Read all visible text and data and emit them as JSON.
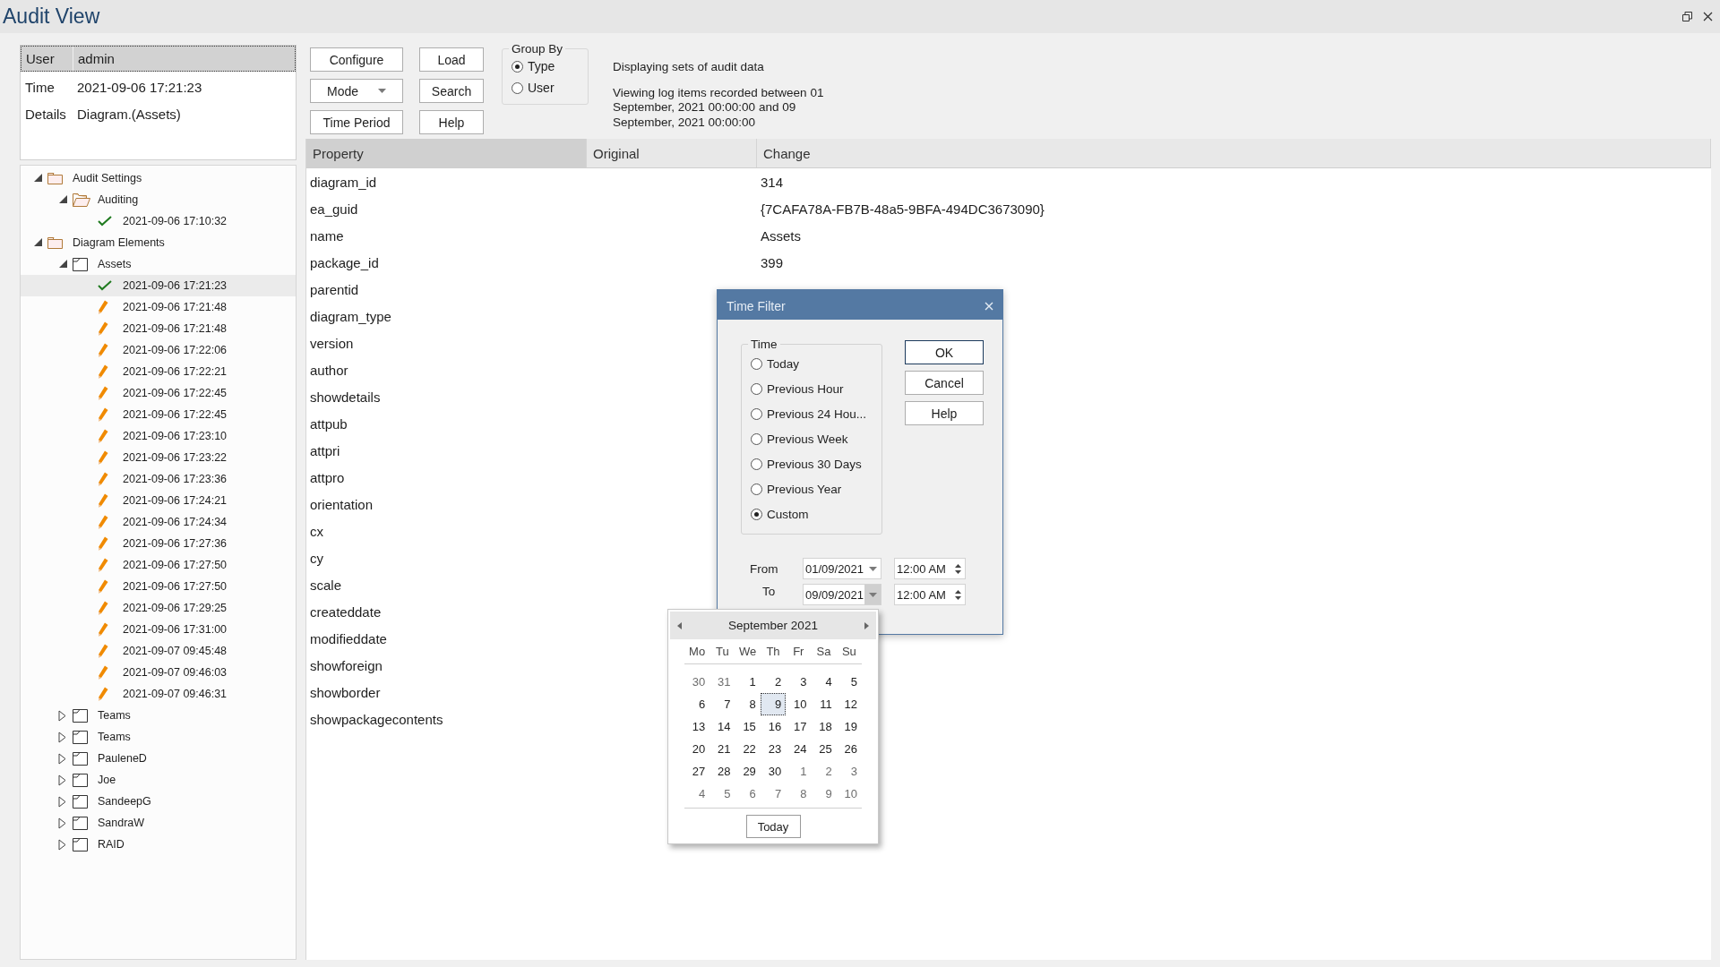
{
  "window": {
    "title": "Audit View"
  },
  "details": {
    "header": {
      "label": "User",
      "value": "admin"
    },
    "rows": [
      {
        "label": "Time",
        "value": "2021-09-06 17:21:23"
      },
      {
        "label": "Details",
        "value": "Diagram.(Assets)"
      }
    ]
  },
  "tree": {
    "items": [
      {
        "label": "Audit Settings",
        "kind": "folder",
        "expanded": true,
        "selected": false,
        "children": [
          {
            "label": "Auditing",
            "kind": "folder-open",
            "expanded": true,
            "selected": false,
            "children": [
              {
                "label": "2021-09-06 17:10:32",
                "kind": "check",
                "selected": false
              }
            ]
          }
        ]
      },
      {
        "label": "Diagram Elements",
        "kind": "folder",
        "expanded": true,
        "selected": false,
        "children": [
          {
            "label": "Assets",
            "kind": "diagram",
            "expanded": true,
            "selected": false,
            "children": [
              {
                "label": "2021-09-06 17:21:23",
                "kind": "check",
                "selected": true
              },
              {
                "label": "2021-09-06 17:21:48",
                "kind": "edit",
                "selected": false
              },
              {
                "label": "2021-09-06 17:21:48",
                "kind": "edit",
                "selected": false
              },
              {
                "label": "2021-09-06 17:22:06",
                "kind": "edit",
                "selected": false
              },
              {
                "label": "2021-09-06 17:22:21",
                "kind": "edit",
                "selected": false
              },
              {
                "label": "2021-09-06 17:22:45",
                "kind": "edit",
                "selected": false
              },
              {
                "label": "2021-09-06 17:22:45",
                "kind": "edit",
                "selected": false
              },
              {
                "label": "2021-09-06 17:23:10",
                "kind": "edit",
                "selected": false
              },
              {
                "label": "2021-09-06 17:23:22",
                "kind": "edit",
                "selected": false
              },
              {
                "label": "2021-09-06 17:23:36",
                "kind": "edit",
                "selected": false
              },
              {
                "label": "2021-09-06 17:24:21",
                "kind": "edit",
                "selected": false
              },
              {
                "label": "2021-09-06 17:24:34",
                "kind": "edit",
                "selected": false
              },
              {
                "label": "2021-09-06 17:27:36",
                "kind": "edit",
                "selected": false
              },
              {
                "label": "2021-09-06 17:27:50",
                "kind": "edit",
                "selected": false
              },
              {
                "label": "2021-09-06 17:27:50",
                "kind": "edit",
                "selected": false
              },
              {
                "label": "2021-09-06 17:29:25",
                "kind": "edit",
                "selected": false
              },
              {
                "label": "2021-09-06 17:31:00",
                "kind": "edit",
                "selected": false
              },
              {
                "label": "2021-09-07 09:45:48",
                "kind": "edit",
                "selected": false
              },
              {
                "label": "2021-09-07 09:46:03",
                "kind": "edit",
                "selected": false
              },
              {
                "label": "2021-09-07 09:46:31",
                "kind": "edit",
                "selected": false
              }
            ]
          },
          {
            "label": "Teams",
            "kind": "diagram",
            "expanded": false,
            "selected": false
          },
          {
            "label": "Teams",
            "kind": "diagram",
            "expanded": false,
            "selected": false
          },
          {
            "label": "PauleneD",
            "kind": "diagram",
            "expanded": false,
            "selected": false
          },
          {
            "label": "Joe",
            "kind": "diagram",
            "expanded": false,
            "selected": false
          },
          {
            "label": "SandeepG",
            "kind": "diagram",
            "expanded": false,
            "selected": false
          },
          {
            "label": "SandraW",
            "kind": "diagram",
            "expanded": false,
            "selected": false
          },
          {
            "label": "RAID",
            "kind": "diagram",
            "expanded": false,
            "selected": false
          }
        ]
      }
    ]
  },
  "toolbar": {
    "buttons": [
      {
        "label": "Configure",
        "kind": "button"
      },
      {
        "label": "Load",
        "kind": "button"
      },
      {
        "label": "Mode",
        "kind": "dropdown"
      },
      {
        "label": "Search",
        "kind": "button"
      },
      {
        "label": "Time Period",
        "kind": "button"
      },
      {
        "label": "Help",
        "kind": "button"
      }
    ],
    "group_by": {
      "title": "Group By",
      "options": [
        {
          "label": "Type",
          "selected": true
        },
        {
          "label": "User",
          "selected": false
        }
      ]
    },
    "info": {
      "summary": "Displaying sets of audit data",
      "range": "Viewing log items recorded between 01 September, 2021 00:00:00 and 09 September, 2021 00:00:00"
    }
  },
  "table": {
    "columns": [
      {
        "label": "Property",
        "sorted": true
      },
      {
        "label": "Original",
        "sorted": false
      },
      {
        "label": "Change",
        "sorted": false
      }
    ],
    "rows": [
      {
        "property": "diagram_id",
        "change": "314"
      },
      {
        "property": "ea_guid",
        "change": "{7CAFA78A-FB7B-48a5-9BFA-494DC3673090}"
      },
      {
        "property": "name",
        "change": "Assets"
      },
      {
        "property": "package_id",
        "change": "399"
      },
      {
        "property": "parentid"
      },
      {
        "property": "diagram_type"
      },
      {
        "property": "version"
      },
      {
        "property": "author"
      },
      {
        "property": "showdetails"
      },
      {
        "property": "attpub"
      },
      {
        "property": "attpri"
      },
      {
        "property": "attpro"
      },
      {
        "property": "orientation"
      },
      {
        "property": "cx"
      },
      {
        "property": "cy"
      },
      {
        "property": "scale"
      },
      {
        "property": "createddate"
      },
      {
        "property": "modifieddate"
      },
      {
        "property": "showforeign"
      },
      {
        "property": "showborder"
      },
      {
        "property": "showpackagecontents"
      }
    ]
  },
  "dialog": {
    "title": "Time Filter",
    "group_title": "Time",
    "options": [
      {
        "label": "Today",
        "selected": false
      },
      {
        "label": "Previous Hour",
        "selected": false
      },
      {
        "label": "Previous 24 Hou...",
        "selected": false
      },
      {
        "label": "Previous Week",
        "selected": false
      },
      {
        "label": "Previous 30 Days",
        "selected": false
      },
      {
        "label": "Previous Year",
        "selected": false
      },
      {
        "label": "Custom",
        "selected": true
      }
    ],
    "buttons": [
      {
        "label": "OK",
        "default": true
      },
      {
        "label": "Cancel",
        "default": false
      },
      {
        "label": "Help",
        "default": false
      }
    ],
    "ranges": [
      {
        "label": "From",
        "date": "01/09/2021",
        "time": "12:00 AM",
        "open": false
      },
      {
        "label": "To",
        "date": "09/09/2021",
        "time": "12:00 AM",
        "open": true
      }
    ]
  },
  "calendar": {
    "title": "September 2021",
    "weekdays": [
      "Mo",
      "Tu",
      "We",
      "Th",
      "Fr",
      "Sa",
      "Su"
    ],
    "today_button": "Today",
    "days": [
      {
        "label": "30",
        "other_month": true,
        "selected": false
      },
      {
        "label": "31",
        "other_month": true,
        "selected": false
      },
      {
        "label": "1",
        "other_month": false,
        "selected": false
      },
      {
        "label": "2",
        "other_month": false,
        "selected": false
      },
      {
        "label": "3",
        "other_month": false,
        "selected": false
      },
      {
        "label": "4",
        "other_month": false,
        "selected": false
      },
      {
        "label": "5",
        "other_month": false,
        "selected": false
      },
      {
        "label": "6",
        "other_month": false,
        "selected": false
      },
      {
        "label": "7",
        "other_month": false,
        "selected": false
      },
      {
        "label": "8",
        "other_month": false,
        "selected": false
      },
      {
        "label": "9",
        "other_month": false,
        "selected": true
      },
      {
        "label": "10",
        "other_month": false,
        "selected": false
      },
      {
        "label": "11",
        "other_month": false,
        "selected": false
      },
      {
        "label": "12",
        "other_month": false,
        "selected": false
      },
      {
        "label": "13",
        "other_month": false,
        "selected": false
      },
      {
        "label": "14",
        "other_month": false,
        "selected": false
      },
      {
        "label": "15",
        "other_month": false,
        "selected": false
      },
      {
        "label": "16",
        "other_month": false,
        "selected": false
      },
      {
        "label": "17",
        "other_month": false,
        "selected": false
      },
      {
        "label": "18",
        "other_month": false,
        "selected": false
      },
      {
        "label": "19",
        "other_month": false,
        "selected": false
      },
      {
        "label": "20",
        "other_month": false,
        "selected": false
      },
      {
        "label": "21",
        "other_month": false,
        "selected": false
      },
      {
        "label": "22",
        "other_month": false,
        "selected": false
      },
      {
        "label": "23",
        "other_month": false,
        "selected": false
      },
      {
        "label": "24",
        "other_month": false,
        "selected": false
      },
      {
        "label": "25",
        "other_month": false,
        "selected": false
      },
      {
        "label": "26",
        "other_month": false,
        "selected": false
      },
      {
        "label": "27",
        "other_month": false,
        "selected": false
      },
      {
        "label": "28",
        "other_month": false,
        "selected": false
      },
      {
        "label": "29",
        "other_month": false,
        "selected": false
      },
      {
        "label": "30",
        "other_month": false,
        "selected": false
      },
      {
        "label": "1",
        "other_month": true,
        "selected": false
      },
      {
        "label": "2",
        "other_month": true,
        "selected": false
      },
      {
        "label": "3",
        "other_month": true,
        "selected": false
      },
      {
        "label": "4",
        "other_month": true,
        "selected": false
      },
      {
        "label": "5",
        "other_month": true,
        "selected": false
      },
      {
        "label": "6",
        "other_month": true,
        "selected": false
      },
      {
        "label": "7",
        "other_month": true,
        "selected": false
      },
      {
        "label": "8",
        "other_month": true,
        "selected": false
      },
      {
        "label": "9",
        "other_month": true,
        "selected": false
      },
      {
        "label": "10",
        "other_month": true,
        "selected": false
      }
    ]
  }
}
